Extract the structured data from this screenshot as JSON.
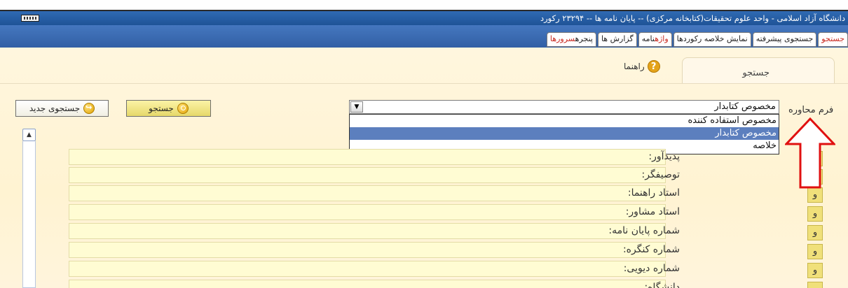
{
  "window": {
    "title": "دانشگاه آزاد اسلامی - واحد علوم تحقیقات(کتابخانه مرکزی) -- پایان نامه ها -- ۲۳۲۹۴ رکورد",
    "keyboard_icon": "keyboard-icon"
  },
  "tabs": [
    {
      "label": "جستجو",
      "active": true
    },
    {
      "label": "جستجوی پیشرفته"
    },
    {
      "label": "نمایش خلاصه رکوردها"
    },
    {
      "label_parts": [
        "واژه",
        "نامه"
      ]
    },
    {
      "label": "گزارش ها"
    },
    {
      "label_parts": [
        "پنجره",
        "سرورها"
      ]
    }
  ],
  "panel": {
    "tab_label": "جستجو",
    "help_label": "راهنما"
  },
  "form": {
    "label": "فرم محاوره",
    "selected": "مخصوص کتابدار",
    "options": [
      "مخصوص استفاده کننده",
      "مخصوص کتابدار",
      "خلاصه"
    ],
    "selected_index": 1
  },
  "buttons": {
    "search": "جستجو",
    "new_search": "جستجوی جدید"
  },
  "fields": [
    {
      "label": "پدیدآور:",
      "conj": ""
    },
    {
      "label": "توصیفگر:",
      "conj": ""
    },
    {
      "label": "استاد راهنما:",
      "conj": "و"
    },
    {
      "label": "استاد مشاور:",
      "conj": "و"
    },
    {
      "label": "شماره پایان نامه:",
      "conj": "و"
    },
    {
      "label": "شماره کنگره:",
      "conj": "و"
    },
    {
      "label": "شماره دیویی:",
      "conj": "و"
    },
    {
      "label": "دانشگاه:",
      "conj": "و"
    }
  ],
  "colors": {
    "titlebar": "#1f5397",
    "tabbar": "#3d6fb6",
    "panel": "#fff5d9",
    "field": "#fffcd3",
    "highlight": "#5c7fbe",
    "arrow": "#e01010"
  }
}
